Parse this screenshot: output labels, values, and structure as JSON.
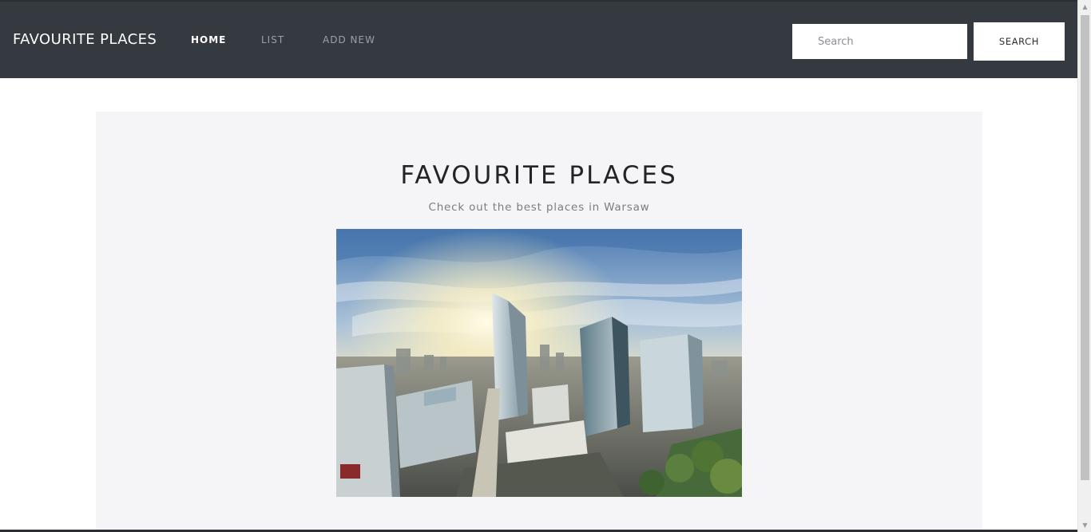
{
  "navbar": {
    "brand": "FAVOURITE PLACES",
    "links": [
      {
        "label": "HOME",
        "active": true
      },
      {
        "label": "LIST",
        "active": false
      },
      {
        "label": "ADD NEW",
        "active": false
      }
    ],
    "search": {
      "placeholder": "Search",
      "value": "",
      "button_label": "SEARCH"
    }
  },
  "hero": {
    "title": "FAVOURITE PLACES",
    "subtitle": "Check out the best places in Warsaw",
    "image_alt": "Warsaw city skyline"
  },
  "icons": {
    "scroll_up": "scroll-up-arrow-icon",
    "scroll_down": "scroll-down-arrow-icon"
  },
  "colors": {
    "navbar_bg": "#343a40",
    "hero_bg": "#f5f5f7",
    "nav_active": "#ffffff",
    "nav_inactive": "#9aa0a6"
  }
}
